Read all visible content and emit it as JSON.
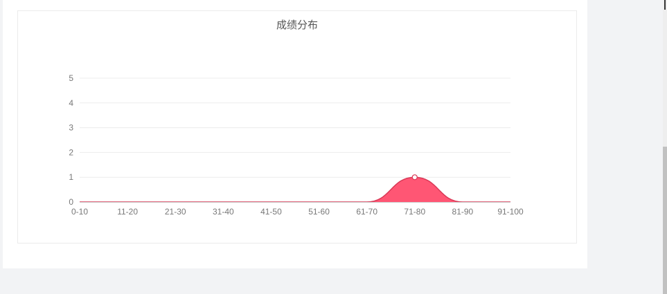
{
  "chart_data": {
    "type": "area",
    "title": "成绩分布",
    "categories": [
      "0-10",
      "11-20",
      "21-30",
      "31-40",
      "41-50",
      "51-60",
      "61-70",
      "71-80",
      "81-90",
      "91-100"
    ],
    "series": [
      {
        "values": [
          0,
          0,
          0,
          0,
          0,
          0,
          0,
          1,
          0,
          0
        ]
      }
    ],
    "ylim": [
      0,
      5
    ],
    "yticks": [
      "0",
      "1",
      "2",
      "3",
      "4",
      "5"
    ],
    "grid": true,
    "smooth": true,
    "color": "#ff4d6d"
  }
}
